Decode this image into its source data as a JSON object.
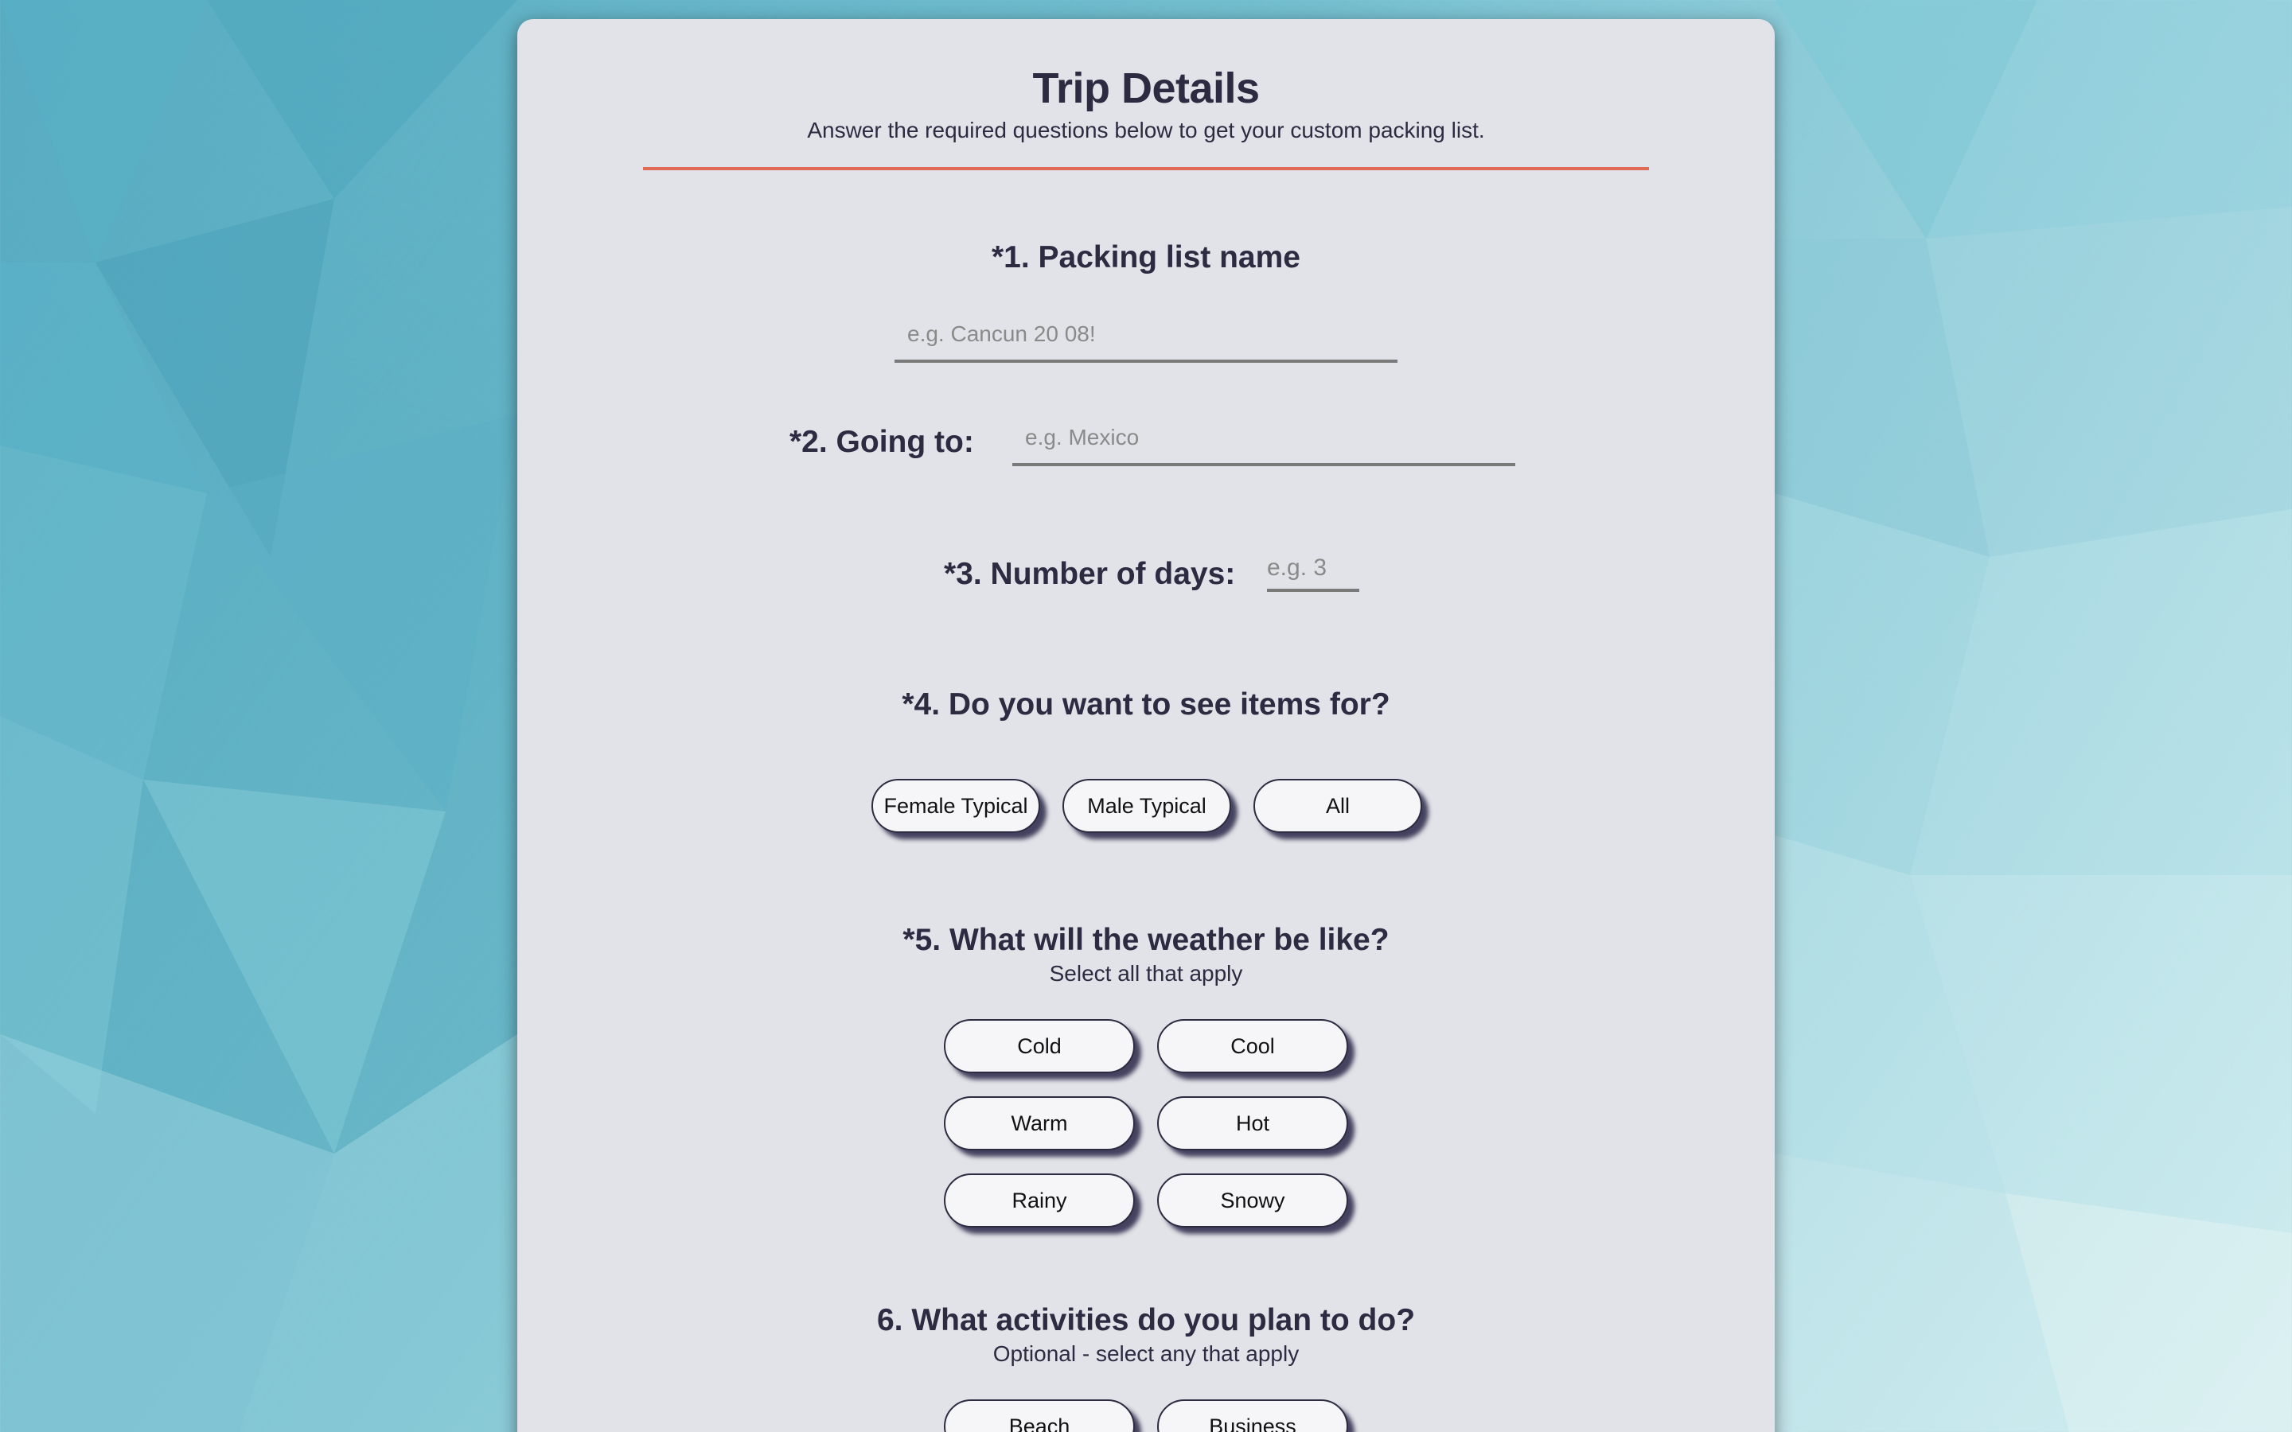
{
  "theme": {
    "accent": "#e06a55",
    "card_bg": "#e2e3e8",
    "text": "#2c2b42"
  },
  "header": {
    "title": "Trip Details",
    "subtitle": "Answer the required questions below to get your custom packing list."
  },
  "q1": {
    "label": "*1. Packing list name",
    "placeholder": "e.g. Cancun 20 08!"
  },
  "q2": {
    "label": "*2. Going to:",
    "placeholder": "e.g. Mexico"
  },
  "q3": {
    "label": "*3. Number of days:",
    "placeholder": "e.g. 3"
  },
  "q4": {
    "label": "*4. Do you want to see items for?",
    "options": [
      "Female Typical",
      "Male Typical",
      "All"
    ]
  },
  "q5": {
    "label": "*5. What will the weather be like?",
    "sublabel": "Select all that apply",
    "options": [
      "Cold",
      "Cool",
      "Warm",
      "Hot",
      "Rainy",
      "Snowy"
    ]
  },
  "q6": {
    "label": "6. What activities do you plan to do?",
    "sublabel": "Optional - select any that apply",
    "options": [
      "Beach",
      "Business"
    ]
  }
}
